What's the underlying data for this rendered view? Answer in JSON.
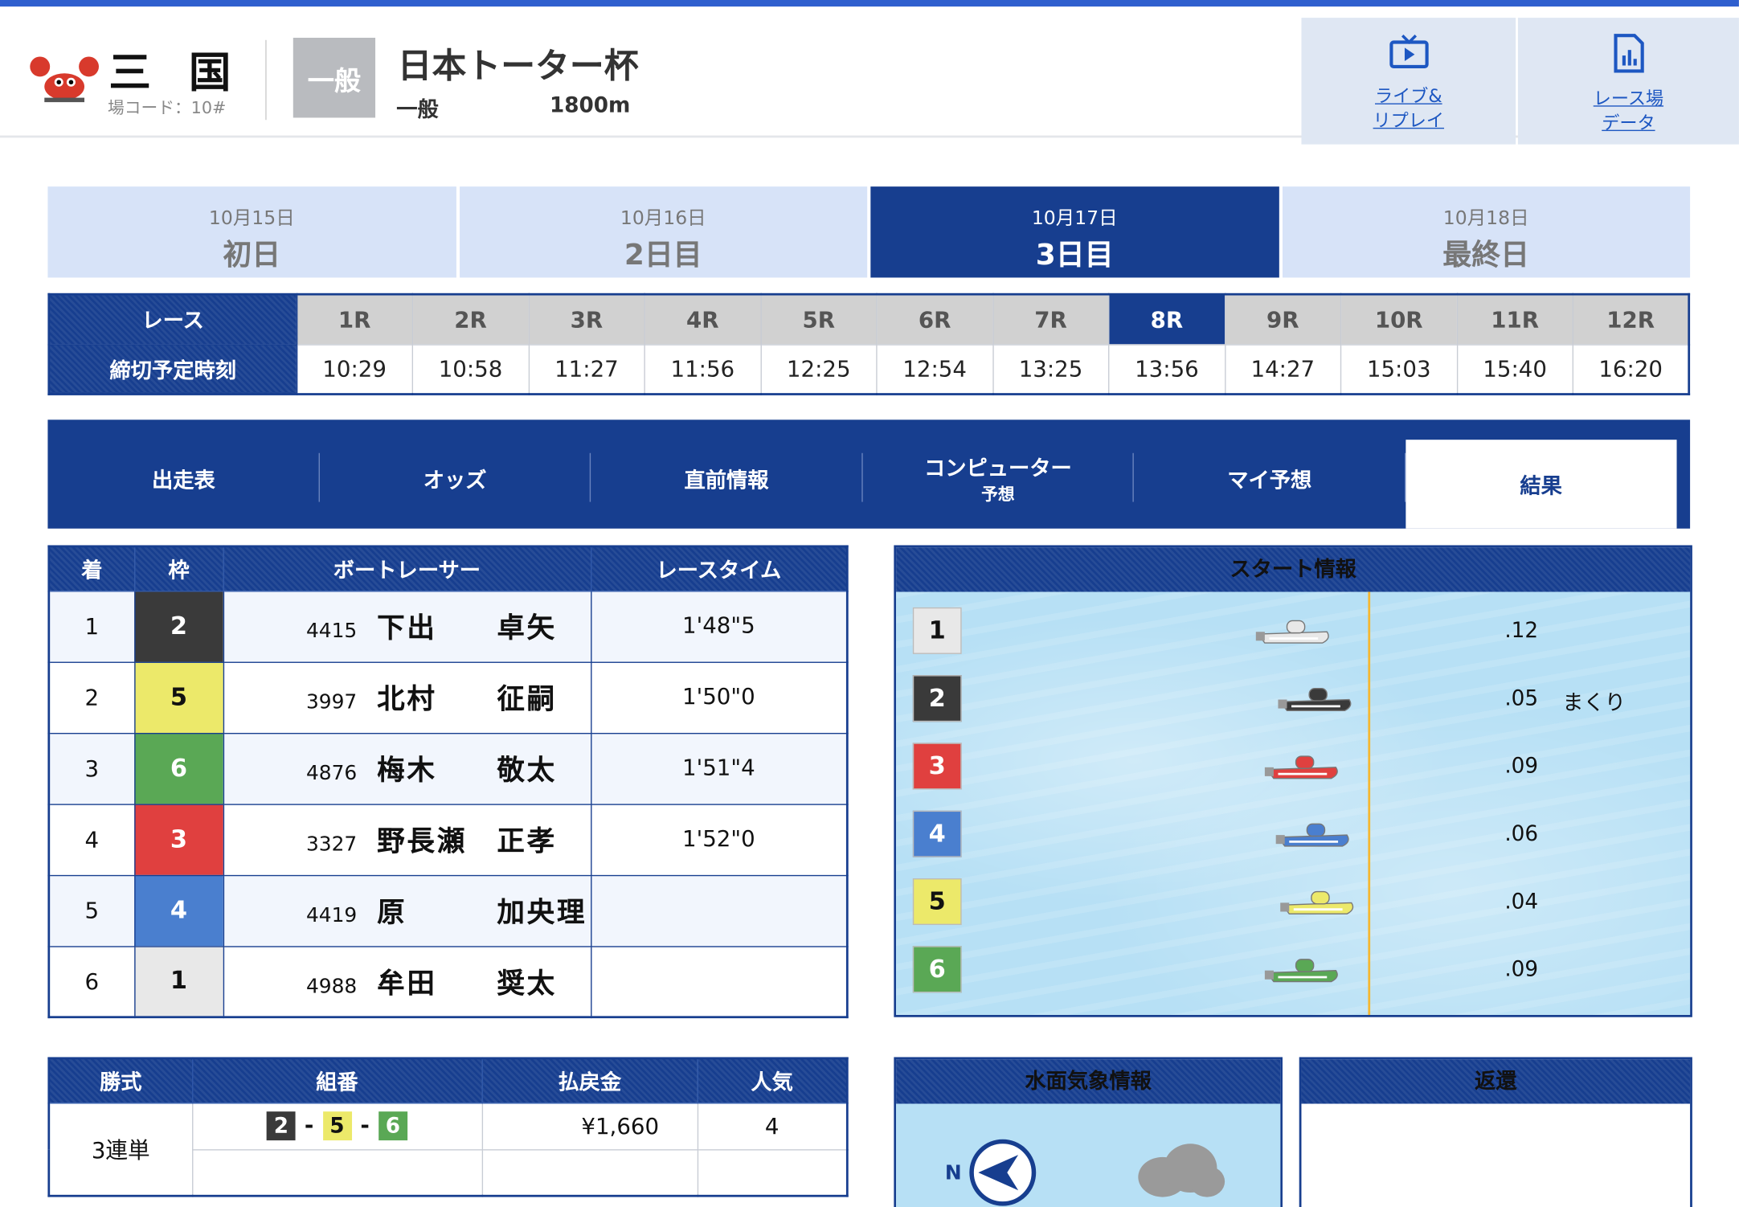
{
  "header": {
    "venue_name": "三国",
    "venue_code": "場コード：10#",
    "grade": "一般",
    "race_title": "日本トーター杯",
    "race_category": "一般",
    "race_distance": "1800m",
    "buttons": [
      {
        "label_1": "ライブ&",
        "label_2": "リプレイ",
        "icon": "tv-play-icon"
      },
      {
        "label_1": "レース場",
        "label_2": "データ",
        "icon": "data-chart-icon"
      }
    ]
  },
  "days": [
    {
      "date": "10月15日",
      "label": "初日",
      "active": false
    },
    {
      "date": "10月16日",
      "label": "2日目",
      "active": false
    },
    {
      "date": "10月17日",
      "label": "3日目",
      "active": true
    },
    {
      "date": "10月18日",
      "label": "最終日",
      "active": false
    }
  ],
  "races": {
    "label_race": "レース",
    "label_deadline": "締切予定時刻",
    "active": "8R",
    "list": [
      {
        "no": "1R",
        "time": "10:29"
      },
      {
        "no": "2R",
        "time": "10:58"
      },
      {
        "no": "3R",
        "time": "11:27"
      },
      {
        "no": "4R",
        "time": "11:56"
      },
      {
        "no": "5R",
        "time": "12:25"
      },
      {
        "no": "6R",
        "time": "12:54"
      },
      {
        "no": "7R",
        "time": "13:25"
      },
      {
        "no": "8R",
        "time": "13:56"
      },
      {
        "no": "9R",
        "time": "14:27"
      },
      {
        "no": "10R",
        "time": "15:03"
      },
      {
        "no": "11R",
        "time": "15:40"
      },
      {
        "no": "12R",
        "time": "16:20"
      }
    ]
  },
  "tabs": [
    {
      "label": "出走表",
      "sub": "",
      "active": false
    },
    {
      "label": "オッズ",
      "sub": "",
      "active": false
    },
    {
      "label": "直前情報",
      "sub": "",
      "active": false
    },
    {
      "label": "コンピューター",
      "sub": "予想",
      "active": false
    },
    {
      "label": "マイ予想",
      "sub": "",
      "active": false
    },
    {
      "label": "結果",
      "sub": "",
      "active": true
    }
  ],
  "result": {
    "headers": [
      "着",
      "枠",
      "ボートレーサー",
      "レースタイム"
    ],
    "rows": [
      {
        "rank": "1",
        "frame": "2",
        "id": "4415",
        "name": "下出　　卓矢",
        "time": "1'48\"5"
      },
      {
        "rank": "2",
        "frame": "5",
        "id": "3997",
        "name": "北村　　征嗣",
        "time": "1'50\"0"
      },
      {
        "rank": "3",
        "frame": "6",
        "id": "4876",
        "name": "梅木　　敬太",
        "time": "1'51\"4"
      },
      {
        "rank": "4",
        "frame": "3",
        "id": "3327",
        "name": "野長瀬　正孝",
        "time": "1'52\"0"
      },
      {
        "rank": "5",
        "frame": "4",
        "id": "4419",
        "name": "原　　　加央理",
        "time": ""
      },
      {
        "rank": "6",
        "frame": "1",
        "id": "4988",
        "name": "牟田　　奨太",
        "time": ""
      }
    ]
  },
  "frame_colors": {
    "1": "#e8e8e8",
    "2": "#3a3a3a",
    "3": "#e0403f",
    "4": "#4a7fcf",
    "5": "#ece96a",
    "6": "#5aa855"
  },
  "frame_text_colors": {
    "1": "#111",
    "2": "#fff",
    "3": "#fff",
    "4": "#fff",
    "5": "#111",
    "6": "#fff"
  },
  "start": {
    "title": "スタート情報",
    "rows": [
      {
        "course": "1",
        "st": ".12",
        "tech": ""
      },
      {
        "course": "2",
        "st": ".05",
        "tech": "まくり"
      },
      {
        "course": "3",
        "st": ".09",
        "tech": ""
      },
      {
        "course": "4",
        "st": ".06",
        "tech": ""
      },
      {
        "course": "5",
        "st": ".04",
        "tech": ""
      },
      {
        "course": "6",
        "st": ".09",
        "tech": ""
      }
    ]
  },
  "payout": {
    "headers": [
      "勝式",
      "組番",
      "払戻金",
      "人気"
    ],
    "type": "3連単",
    "combo": [
      "2",
      "5",
      "6"
    ],
    "amount": "¥1,660",
    "popularity": "4"
  },
  "weather": {
    "title": "水面気象情報",
    "wind_label": "N"
  },
  "refund": {
    "title": "返還"
  }
}
